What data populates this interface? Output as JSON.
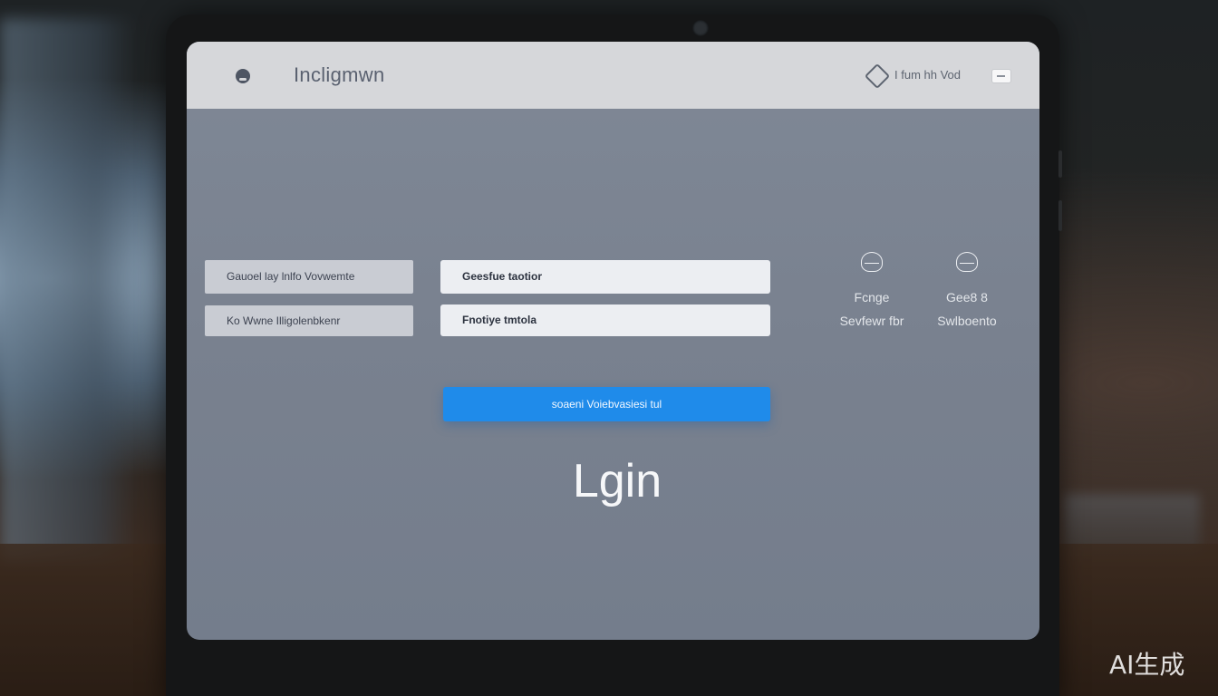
{
  "app": {
    "title": "Incligmwn",
    "logo_icon": "app-logo-icon"
  },
  "header": {
    "right_label": "I fum hh Vod",
    "tag_icon": "tag-icon",
    "action_icon": "minimize-icon"
  },
  "form": {
    "rows": [
      {
        "label": "Gauoel lay lnlfo Vovwemte",
        "value": "Geesfue taotior"
      },
      {
        "label": "Ko Wwne Illigolenbkenr",
        "value": "Fnotiye tmtola"
      }
    ],
    "submit_label": "soaeni Voiebvasiesi tul"
  },
  "login_heading": "Lgin",
  "users": [
    {
      "icon": "user-avatar-icon",
      "line1": "Fcnge",
      "line2": "Sevfewr fbr"
    },
    {
      "icon": "user-avatar-icon",
      "line1": "Gee8 8",
      "line2": "Swlboento"
    }
  ],
  "watermark": "AI生成",
  "colors": {
    "accent": "#1f8bea",
    "screen_bg": "#7a8392",
    "topbar_bg": "#d6d7da"
  }
}
